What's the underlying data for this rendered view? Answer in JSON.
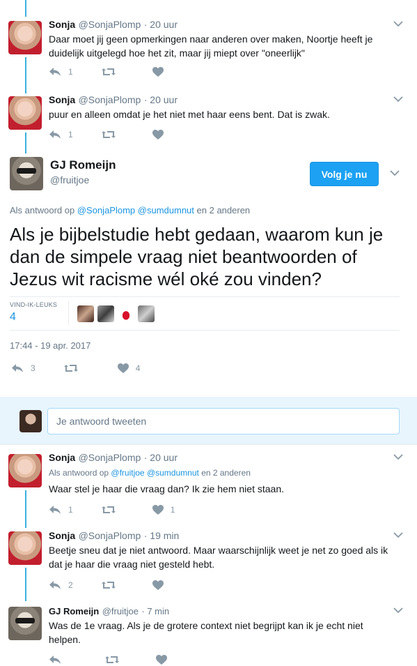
{
  "tweets_top": [
    {
      "name": "Sonja",
      "handle": "@SonjaPlomp",
      "time": "· 20 uur",
      "text": "Daar moet jij geen opmerkingen naar anderen over maken, Noortje heeft je duidelijk uitgelegd hoe het zit, maar jij miept over \"oneerlijk\"",
      "reply_count": "1"
    },
    {
      "name": "Sonja",
      "handle": "@SonjaPlomp",
      "time": "· 20 uur",
      "text": "puur en alleen omdat je het niet met haar eens bent. Dat is zwak.",
      "reply_count": "1"
    }
  ],
  "main_tweet": {
    "name": "GJ Romeijn",
    "handle": "@fruitjoe",
    "follow_label": "Volg je nu",
    "reply_prefix": "Als antwoord op",
    "reply_mention_1": "@SonjaPlomp",
    "reply_mention_2": "@sumdumnut",
    "reply_suffix": "en 2 anderen",
    "text": "Als je bijbelstudie hebt gedaan, waarom kun je dan de simpele vraag niet beantwoorden of Jezus wit racisme wél oké zou vinden?",
    "likes_label": "VIND-IK-LEUKS",
    "likes_count": "4",
    "timestamp": "17:44 - 19 apr. 2017",
    "reply_count": "3",
    "like_count": "4"
  },
  "reply_box": {
    "placeholder": "Je antwoord tweeten"
  },
  "tweets_bottom": [
    {
      "name": "Sonja",
      "handle": "@SonjaPlomp",
      "time": "· 20 uur",
      "reply_prefix": "Als antwoord op",
      "reply_mention_1": "@fruitjoe",
      "reply_mention_2": "@sumdumnut",
      "reply_suffix": "en 2 anderen",
      "text": "Waar stel je haar die vraag dan? Ik zie hem niet staan.",
      "reply_count": "1",
      "like_count": "1"
    },
    {
      "name": "Sonja",
      "handle": "@SonjaPlomp",
      "time": "· 19 min",
      "text": "Beetje sneu dat je niet antwoord. Maar waarschijnlijk weet je net zo goed als ik dat je haar die vraag niet gesteld hebt.",
      "reply_count": "2"
    },
    {
      "name": "GJ Romeijn",
      "handle": "@fruitjoe",
      "time": "· 7 min",
      "text": "Was de 1e vraag. Als je de grotere context niet begrijpt kan ik je echt niet helpen."
    }
  ],
  "colors": {
    "accent": "#1da1f2",
    "thread_line": "#3bb0dd",
    "text_secondary": "#657786"
  },
  "icons": [
    "reply-icon",
    "retweet-icon",
    "heart-icon",
    "chevron-down-icon"
  ]
}
